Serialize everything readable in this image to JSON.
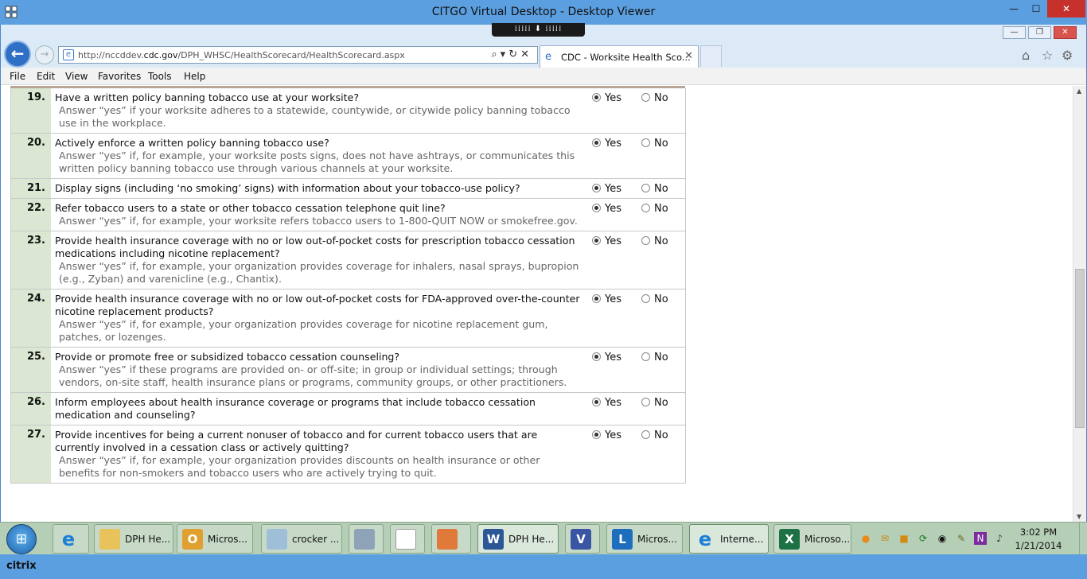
{
  "outer_window": {
    "title": "CITGO Virtual Desktop - Desktop Viewer",
    "minimize": "—",
    "maximize": "☐",
    "close": "✕",
    "toolbar_handle": "⁞⁞⁞⁞⁞ ⬇ ⁞⁞⁞⁞⁞"
  },
  "browser": {
    "back": "←",
    "forward": "→",
    "address_url_prefix": "http://nccddev.",
    "address_url_domain": "cdc.gov",
    "address_url_path": "/DPH_WHSC/HealthScorecard/HealthScorecard.aspx",
    "address_tools": "⌕▾↻✕",
    "tab_label": "CDC - Worksite Health Sco...",
    "tab_close": "✕",
    "home_icon": "⌂",
    "favorites_icon": "☆",
    "settings_icon": "⚙",
    "win_min": "—",
    "win_restore": "❐",
    "win_close": "✕"
  },
  "menu": {
    "file": "File",
    "edit": "Edit",
    "view": "View",
    "favorites": "Favorites",
    "tools": "Tools",
    "help": "Help"
  },
  "options": {
    "yes": "Yes",
    "no": "No"
  },
  "questions": [
    {
      "num": "19.",
      "text": "Have a written policy banning tobacco use at your worksite?",
      "hint": "Answer “yes” if your worksite adheres to a statewide, countywide, or citywide policy banning tobacco use in the workplace.",
      "answer": "yes"
    },
    {
      "num": "20.",
      "text": "Actively enforce a written policy banning tobacco use?",
      "hint": "Answer “yes” if, for example, your worksite posts signs, does not have ashtrays, or communicates this written policy banning tobacco use through various channels at your worksite.",
      "answer": "yes"
    },
    {
      "num": "21.",
      "text": "Display signs (including ‘no smoking’ signs) with information about your tobacco-use policy?",
      "hint": "",
      "answer": "yes"
    },
    {
      "num": "22.",
      "text": "Refer tobacco users to a state or other tobacco cessation telephone quit line?",
      "hint": "Answer “yes” if, for example, your worksite refers tobacco users to 1-800-QUIT NOW or smokefree.gov.",
      "answer": "yes"
    },
    {
      "num": "23.",
      "text": "Provide health insurance coverage with no or low out-of-pocket costs for prescription tobacco cessation medications including nicotine replacement?",
      "hint": "Answer “yes” if, for example, your organization provides coverage for inhalers, nasal sprays, bupropion (e.g., Zyban) and varenicline (e.g., Chantix).",
      "answer": "yes"
    },
    {
      "num": "24.",
      "text": "Provide health insurance coverage with no or low out-of-pocket costs for FDA-approved over-the-counter nicotine replacement products?",
      "hint": "Answer “yes” if, for example, your organization provides coverage for nicotine replacement gum, patches, or lozenges.",
      "answer": "yes"
    },
    {
      "num": "25.",
      "text": "Provide or promote free or subsidized tobacco cessation counseling?",
      "hint": "Answer “yes” if these programs are provided on- or off-site; in group or individual settings; through vendors, on-site staff, health insurance plans or programs, community groups, or other practitioners.",
      "answer": "yes"
    },
    {
      "num": "26.",
      "text": "Inform employees about health insurance coverage or programs that include tobacco cessation medication and counseling?",
      "hint": "",
      "answer": "yes"
    },
    {
      "num": "27.",
      "text": "Provide incentives for being a current nonuser of tobacco and for current tobacco users that are currently involved in a cessation class or actively quitting?",
      "hint": "Answer “yes” if, for example, your organization provides discounts on health insurance or other benefits for non-smokers and tobacco users who are actively trying to quit.",
      "answer": "yes"
    }
  ],
  "taskbar": {
    "start_glyph": "⊞",
    "buttons": [
      {
        "label": "DPH He...",
        "icon": "folder-icon"
      },
      {
        "label": "Micros...",
        "icon": "outlook-icon"
      },
      {
        "label": "crocker ...",
        "icon": "notepad-icon"
      },
      {
        "label": "DPH He...",
        "icon": "word-icon"
      },
      {
        "label": "Micros...",
        "icon": "lync-icon"
      },
      {
        "label": "Interne...",
        "icon": "ie-icon"
      },
      {
        "label": "Microso...",
        "icon": "excel-icon"
      }
    ],
    "clock_time": "3:02 PM",
    "clock_date": "1/21/2014"
  },
  "citrix_bar": {
    "logo": "citrix"
  },
  "colors": {
    "citrix_blue": "#5b9fe0",
    "question_num_bg": "#dbe7d2",
    "taskbar_bg": "#b5ceb6",
    "close_red": "#c7312b"
  }
}
